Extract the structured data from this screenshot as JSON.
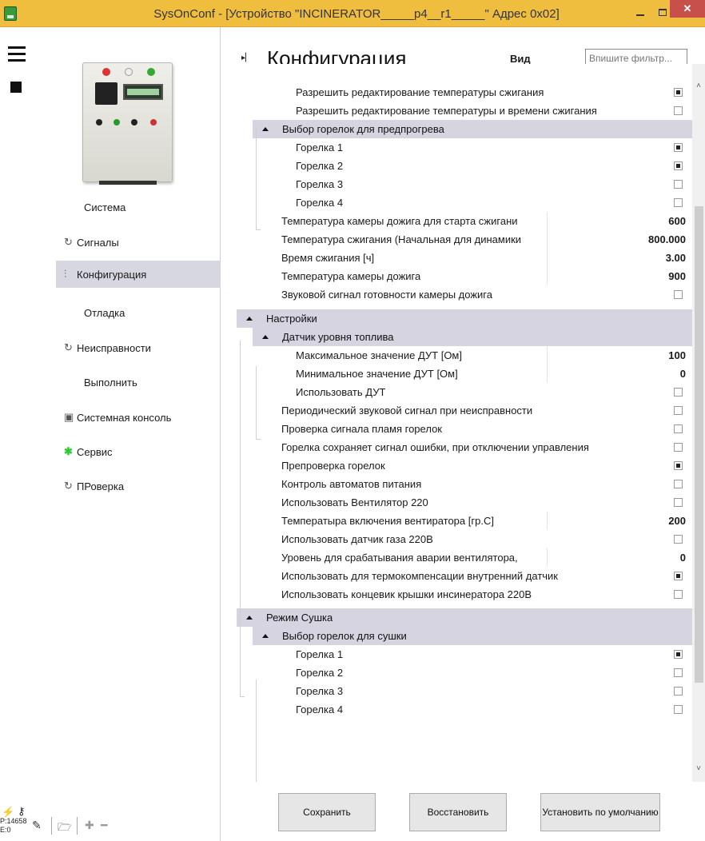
{
  "window": {
    "title": "SysOnConf - [Устройство \"INCINERATOR_____p4__r1_____\" Адрес 0x02]",
    "close_glyph": "✕"
  },
  "sidebar": {
    "items": [
      {
        "label": "Система",
        "icon": "",
        "active": false
      },
      {
        "label": "Сигналы",
        "icon": "refresh-icon",
        "active": false
      },
      {
        "label": "Конфигурация",
        "icon": "sliders-icon",
        "active": true
      },
      {
        "label": "Отладка",
        "icon": "",
        "active": false
      },
      {
        "label": "Неисправности",
        "icon": "refresh-icon",
        "active": false
      },
      {
        "label": "Выполнить",
        "icon": "",
        "active": false
      },
      {
        "label": "Системная консоль",
        "icon": "console-icon",
        "active": false
      },
      {
        "label": "Сервис",
        "icon": "asterisk-icon",
        "active": false
      },
      {
        "label": "ПРоверка",
        "icon": "refresh-icon",
        "active": false
      }
    ],
    "status": {
      "p": "P:14658",
      "e": "E:0"
    }
  },
  "header": {
    "title": "Конфигурация",
    "view_label": "Вид",
    "filter_placeholder": "Впишите фильтр..."
  },
  "rows": [
    {
      "label": "Разрешить редактирование температуры сжигания",
      "checked": true
    },
    {
      "label": "Разрешить редактирование температуры и времени сжигания",
      "checked": false
    },
    {
      "label": "Выбор горелок для предпрогрева",
      "header": true
    },
    {
      "label": "Горелка 1",
      "checked": true
    },
    {
      "label": "Горелка 2",
      "checked": true
    },
    {
      "label": "Горелка 3",
      "checked": false
    },
    {
      "label": "Горелка 4",
      "checked": false
    },
    {
      "label": "Температура камеры дожига для старта сжигани",
      "value": "600"
    },
    {
      "label": "Температура сжигания (Начальная для динамики",
      "value": "800.000"
    },
    {
      "label": "Время сжигания [ч]",
      "value": "3.00"
    },
    {
      "label": "Температура камеры дожига",
      "value": "900"
    },
    {
      "label": "Звуковой сигнал готовности камеры дожига",
      "checked": false
    },
    {
      "label": "Настройки",
      "header": true
    },
    {
      "label": "Датчик уровня топлива",
      "header": true
    },
    {
      "label": "Максимальное значение ДУТ [Ом]",
      "value": "100"
    },
    {
      "label": "Минимальное значение ДУТ [Ом]",
      "value": "0"
    },
    {
      "label": "Использовать ДУТ",
      "checked": false
    },
    {
      "label": "Периодический звуковой сигнал при неисправности",
      "checked": false
    },
    {
      "label": "Проверка сигнала пламя горелок",
      "checked": false
    },
    {
      "label": "Горелка сохраняет сигнал ошибки, при отключении управления",
      "checked": false
    },
    {
      "label": "Препроверка горелок",
      "checked": true
    },
    {
      "label": "Контроль автоматов питания",
      "checked": false
    },
    {
      "label": "Использовать Вентилятор 220",
      "checked": false
    },
    {
      "label": "Температыра включения вентиратора [гр.С]",
      "value": "200"
    },
    {
      "label": "Использовать датчик газа 220В",
      "checked": false
    },
    {
      "label": "Уровень для срабатывания аварии вентилятора,",
      "value": "0"
    },
    {
      "label": "Использовать для термокомпенсации внутренний датчик",
      "checked": true
    },
    {
      "label": "Использовать концевик крышки инсинератора 220В",
      "checked": false
    },
    {
      "label": "Режим Сушка",
      "header": true
    },
    {
      "label": "Выбор горелок для сушки",
      "header": true
    },
    {
      "label": "Горелка 1",
      "checked": true
    },
    {
      "label": "Горелка 2",
      "checked": false
    },
    {
      "label": "Горелка 3",
      "checked": false
    },
    {
      "label": "Горелка 4",
      "checked": false
    }
  ],
  "buttons": {
    "save": "Сохранить",
    "restore": "Восстановить",
    "defaults": "Установить по умолчанию"
  }
}
